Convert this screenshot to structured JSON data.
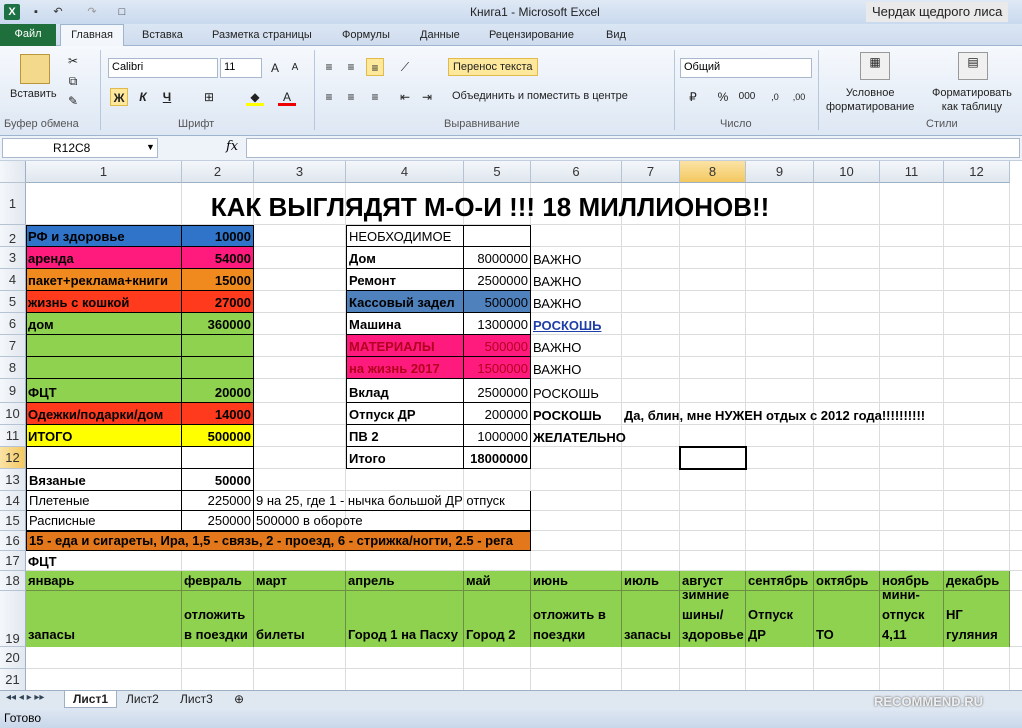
{
  "window": {
    "title": "Книга1  -  Microsoft Excel",
    "watermark": "Чердак щедрого лиса",
    "logo": "X"
  },
  "tabs": [
    "Файл",
    "Главная",
    "Вставка",
    "Разметка страницы",
    "Формулы",
    "Данные",
    "Рецензирование",
    "Вид"
  ],
  "ribbon": {
    "paste": "Вставить",
    "clipboard": "Буфер обмена",
    "font_group": "Шрифт",
    "font_name": "Calibri",
    "font_size": "11",
    "bold": "Ж",
    "italic": "К",
    "underline": "Ч",
    "wrap_text": "Перенос текста",
    "merge_center": "Объединить и поместить в центре",
    "align_group": "Выравнивание",
    "number_format": "Общий",
    "number_group": "Число",
    "cond_format": "Условное\nформатирование",
    "format_table": "Форматировать\nкак таблицу",
    "styles_group": "Стили"
  },
  "formula_bar": {
    "name_box": "R12C8",
    "fx": "fx",
    "value": ""
  },
  "columns": [
    "1",
    "2",
    "3",
    "4",
    "5",
    "6",
    "7",
    "8",
    "9",
    "10",
    "11",
    "12"
  ],
  "rows": [
    "1",
    "2",
    "3",
    "4",
    "5",
    "6",
    "7",
    "8",
    "9",
    "10",
    "11",
    "12",
    "13",
    "14",
    "15",
    "16",
    "17",
    "18",
    "19",
    "20",
    "21"
  ],
  "title": "КАК ВЫГЛЯДЯТ М-О-И !!! 18 МИЛЛИОНОВ!!",
  "left_table": [
    {
      "label": "РФ и здоровье",
      "value": "10000",
      "color": "#2f74c8"
    },
    {
      "label": "аренда",
      "value": "54000",
      "color": "#ff1b7d"
    },
    {
      "label": "пакет+реклама+книги",
      "value": "15000",
      "color": "#f08a1f"
    },
    {
      "label": "жизнь с кошкой",
      "value": "27000",
      "color": "#ff3a1d"
    },
    {
      "label": "дом",
      "value": "360000",
      "color": "#8ed24f"
    },
    {
      "label": "",
      "value": "",
      "color": "#8ed24f"
    },
    {
      "label": "",
      "value": "",
      "color": "#8ed24f"
    },
    {
      "label": "ФЦТ",
      "value": "20000",
      "color": "#8ed24f"
    },
    {
      "label": "Одежки/подарки/дом",
      "value": "14000",
      "color": "#ff3a1d"
    },
    {
      "label": "ИТОГО",
      "value": "500000",
      "color": "#ffff00"
    }
  ],
  "right_table": {
    "header": "НЕОБХОДИМОЕ",
    "rows": [
      {
        "label": "Дом",
        "value": "8000000",
        "note": "ВАЖНО",
        "color": ""
      },
      {
        "label": "Ремонт",
        "value": "2500000",
        "note": "ВАЖНО",
        "color": ""
      },
      {
        "label": "Кассовый задел",
        "value": "500000",
        "note": "ВАЖНО",
        "color": "#4f81bd"
      },
      {
        "label": "Машина",
        "value": "1300000",
        "note": "РОСКОШЬ",
        "color": ""
      },
      {
        "label": "МАТЕРИАЛЫ",
        "value": "500000",
        "note": "ВАЖНО",
        "color": "#ff1b7d"
      },
      {
        "label": "на жизнь 2017",
        "value": "1500000",
        "note": "ВАЖНО",
        "color": "#ff1b7d"
      },
      {
        "label": "Вклад",
        "value": "2500000",
        "note": "РОСКОШЬ",
        "color": ""
      },
      {
        "label": "Отпуск ДР",
        "value": "200000",
        "note": "РОСКОШЬ",
        "color": ""
      },
      {
        "label": "ПВ 2",
        "value": "1000000",
        "note": "ЖЕЛАТЕЛЬНО",
        "color": ""
      },
      {
        "label": "Итого",
        "value": "18000000",
        "note": "",
        "color": ""
      }
    ],
    "comment": "Да, блин, мне НУЖЕН отдых с 2012 года!!!!!!!!!!"
  },
  "small_table": [
    {
      "label": "Вязаные",
      "value": "50000",
      "note": ""
    },
    {
      "label": "Плетеные",
      "value": "225000",
      "note": "9 на 25, где 1 - нычка большой ДР отпуск"
    },
    {
      "label": "Расписные",
      "value": "250000",
      "note": "500000 в обороте"
    }
  ],
  "row16": "15 - еда и сигареты, Ира, 1,5 - связь, 2 - проезд,  6 - стрижка/ногти, 2.5 - рега",
  "row17": "ФЦТ",
  "months": [
    "январь",
    "февраль",
    "март",
    "апрель",
    "май",
    "июнь",
    "июль",
    "август",
    "сентябрь",
    "октябрь",
    "ноябрь",
    "декабрь"
  ],
  "plans": [
    "запасы",
    "отложить в поездки",
    "билеты",
    "Город 1 на Пасху",
    "Город 2",
    "отложить в поездки",
    "запасы",
    "зимние шины/ здоровье",
    "Отпуск ДР",
    "ТО",
    "мини-отпуск 4,11",
    "НГ гуляния"
  ],
  "sheets": [
    "Лист1",
    "Лист2",
    "Лист3"
  ],
  "status": "Готово",
  "recommend": "RECOMMEND.RU"
}
